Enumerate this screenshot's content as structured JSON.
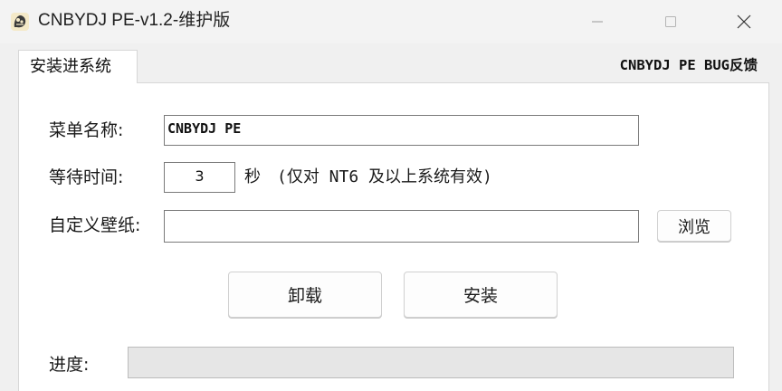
{
  "window": {
    "title": "CNBYDJ PE-v1.2-维护版",
    "icon": "app-icon",
    "controls": [
      "minimize-icon",
      "maximize-icon",
      "close-icon"
    ]
  },
  "tabs": [
    {
      "label": "安装进系统",
      "active": true
    }
  ],
  "header": {
    "bug_feedback": "CNBYDJ PE BUG反馈"
  },
  "form": {
    "menu_name": {
      "label": "菜单名称:",
      "value": "CNBYDJ PE"
    },
    "wait_time": {
      "label": "等待时间:",
      "value": "3",
      "unit": "秒",
      "note": "(仅对 NT6 及以上系统有效)"
    },
    "wallpaper": {
      "label": "自定义壁纸:",
      "value": "",
      "browse_label": "浏览"
    }
  },
  "actions": {
    "uninstall_label": "卸载",
    "install_label": "安装"
  },
  "progress": {
    "label": "进度:",
    "value": 0
  },
  "colors": {
    "progress_fill": "#06b025",
    "field_border": "#7a7a7a"
  }
}
